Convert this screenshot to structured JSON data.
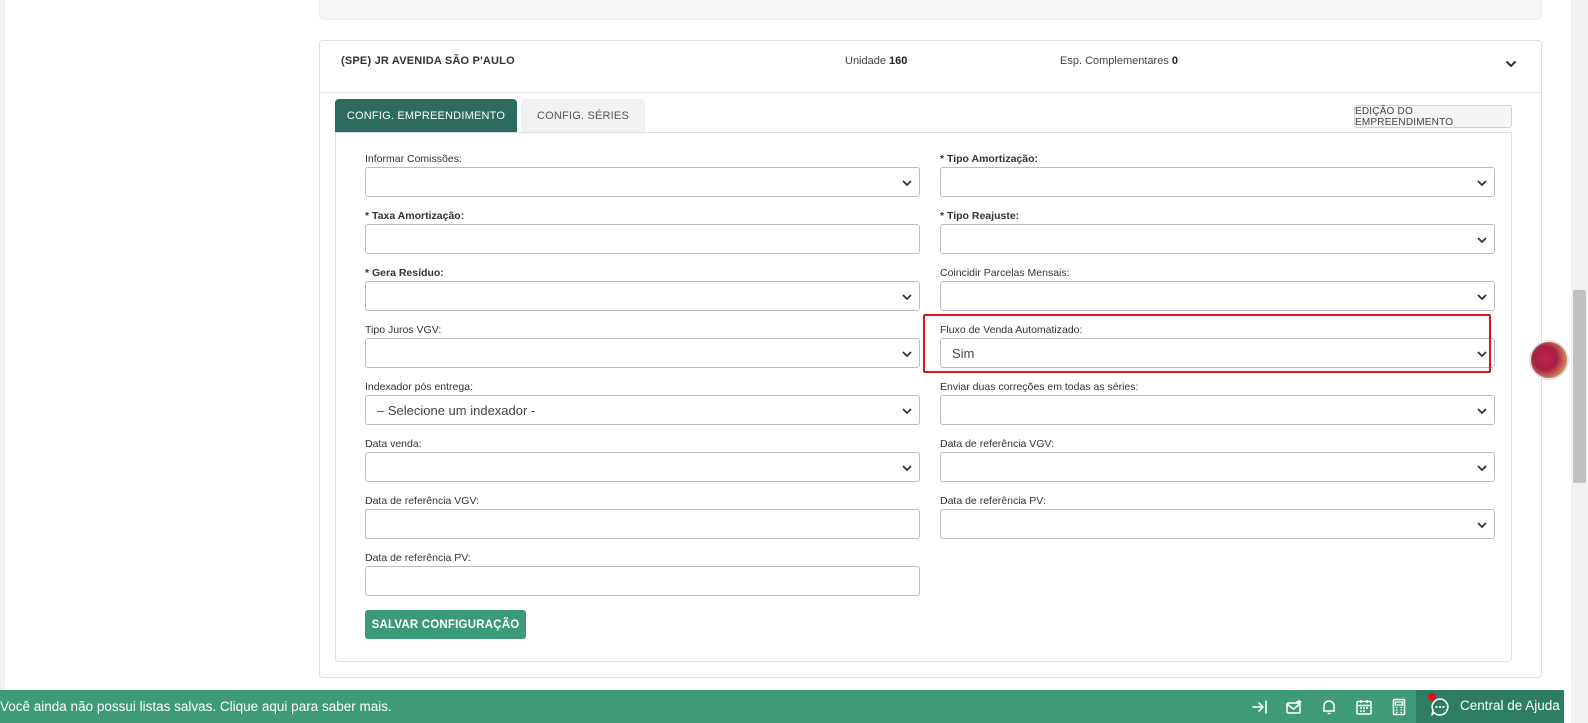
{
  "header": {
    "company": "(SPE) JR AVENIDA SÃO P'AULO",
    "unit_label": "Unidade",
    "unit_value": "160",
    "esp_label": "Esp. Complementares",
    "esp_value": "0"
  },
  "tabs": [
    {
      "label": "CONFIG. EMPREENDIMENTO",
      "active": true
    },
    {
      "label": "CONFIG. SÉRIES",
      "active": false
    }
  ],
  "edit_button": "EDIÇÃO DO EMPREENDIMENTO",
  "fields": {
    "informar_comissoes": {
      "label": "Informar Comissões:",
      "value": ""
    },
    "tipo_amortizacao": {
      "label": "* Tipo Amortização:",
      "value": ""
    },
    "taxa_amortizacao": {
      "label": "* Taxa Amortização:",
      "value": ""
    },
    "tipo_reajuste": {
      "label": "* Tipo Reajuste:",
      "value": ""
    },
    "gera_residuo": {
      "label": "* Gera Resíduo:",
      "value": ""
    },
    "coincidir_parcelas": {
      "label": "Coincidir Parcelas Mensais:",
      "value": ""
    },
    "tipo_juros_vgv": {
      "label": "Tipo Juros VGV:",
      "value": ""
    },
    "fluxo_venda": {
      "label": "Fluxo de Venda Automatizado:",
      "value": "Sim"
    },
    "indexador_pos": {
      "label": "Indexador pós entrega:",
      "value": "– Selecione um indexador -"
    },
    "enviar_duas_correcoes": {
      "label": "Enviar duas correções em todas as séries:",
      "value": ""
    },
    "data_venda": {
      "label": "Data venda:",
      "value": ""
    },
    "data_ref_vgv_right": {
      "label": "Data de referência VGV:",
      "value": ""
    },
    "data_ref_vgv_left": {
      "label": "Data de referência VGV:",
      "value": ""
    },
    "data_ref_pv_right": {
      "label": "Data de referência PV:",
      "value": ""
    },
    "data_ref_pv_left": {
      "label": "Data de referência PV:",
      "value": ""
    }
  },
  "save_button": "SALVAR CONFIGURAÇÃO",
  "bottom_bar": {
    "message": "Você ainda não possui listas salvas. Clique aqui para saber mais.",
    "help_label": "Central de Ajuda"
  },
  "colors": {
    "tab_active": "#2d6b5e",
    "save_button": "#3c9a7c",
    "bottom_bar": "#3f9a78",
    "highlight": "#e0121b"
  }
}
